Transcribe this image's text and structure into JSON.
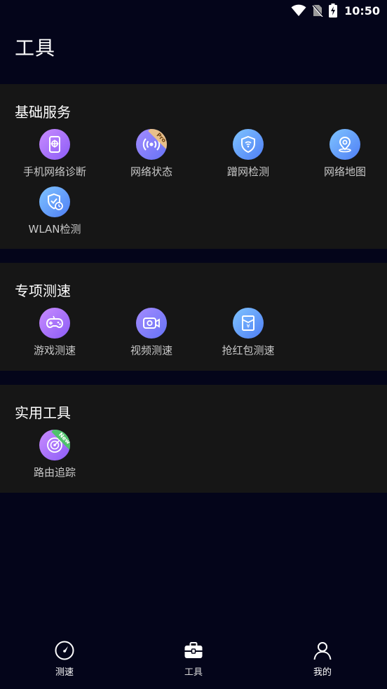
{
  "status_bar": {
    "time": "10:50"
  },
  "page_title": "工具",
  "sections": [
    {
      "title": "基础服务",
      "items": [
        {
          "label": "手机网络诊断",
          "icon": "phone-diagnose-icon"
        },
        {
          "label": "网络状态",
          "icon": "signal-broadcast-icon",
          "badge": "Pro"
        },
        {
          "label": "蹭网检测",
          "icon": "shield-wifi-icon"
        },
        {
          "label": "网络地图",
          "icon": "map-pin-icon"
        },
        {
          "label": "WLAN检测",
          "icon": "shield-clock-icon"
        }
      ]
    },
    {
      "title": "专项测速",
      "items": [
        {
          "label": "游戏测速",
          "icon": "gamepad-icon"
        },
        {
          "label": "视频测速",
          "icon": "video-camera-icon"
        },
        {
          "label": "抢红包测速",
          "icon": "red-envelope-icon"
        }
      ]
    },
    {
      "title": "实用工具",
      "items": [
        {
          "label": "路由追踪",
          "icon": "radar-icon",
          "badge": "New"
        }
      ]
    }
  ],
  "bottom_nav": [
    {
      "label": "测速",
      "icon": "speedometer-icon"
    },
    {
      "label": "工具",
      "icon": "toolbox-icon"
    },
    {
      "label": "我的",
      "icon": "person-icon"
    }
  ],
  "colors": {
    "background": "#04051a",
    "section_bg": "#161616",
    "label_gray": "#c8c8c8"
  }
}
